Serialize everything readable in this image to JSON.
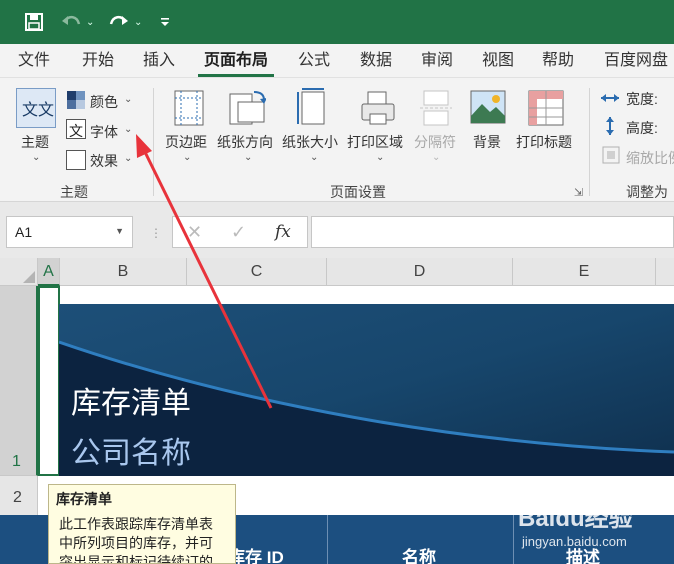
{
  "quick_access": {
    "save": "save-icon",
    "undo": "undo-icon",
    "redo": "redo-icon"
  },
  "tabs": [
    "文件",
    "开始",
    "插入",
    "页面布局",
    "公式",
    "数据",
    "审阅",
    "视图",
    "帮助",
    "百度网盘"
  ],
  "active_tab": "页面布局",
  "ribbon": {
    "themes": {
      "title": "主题",
      "theme_button": "主题",
      "theme_icon_text": "文文",
      "colors": "颜色",
      "fonts": "字体",
      "font_icon_text": "文",
      "effects": "效果"
    },
    "page_setup": {
      "title": "页面设置",
      "margins": "页边距",
      "orientation": "纸张方向",
      "size": "纸张大小",
      "print_area": "打印区域",
      "breaks": "分隔符",
      "background": "背景",
      "print_titles": "打印标题"
    },
    "scale": {
      "title": "调整为合",
      "width": "宽度:",
      "height": "高度:",
      "scale": "缩放比例"
    }
  },
  "formula_bar": {
    "name_box": "A1",
    "cancel": "✕",
    "enter": "✓",
    "fx": "fx",
    "value": ""
  },
  "columns": [
    "A",
    "B",
    "C",
    "D",
    "E"
  ],
  "rows": [
    "1",
    "2"
  ],
  "banner": {
    "title": "库存清单",
    "subtitle": "公司名称"
  },
  "table_headers": [
    "库存 ID",
    "名称",
    "描述"
  ],
  "tooltip": {
    "title": "库存清单",
    "lines": [
      "此工作表跟踪库存清单表",
      "中所列项目的库存，并可",
      "突出显示和标记待续订的"
    ]
  },
  "watermark": {
    "text": "Baidu经验",
    "url": "jingyan.baidu.com"
  },
  "colors": {
    "excel_green": "#217346",
    "banner_navy": "#163a5c",
    "header_blue": "#1c4f80",
    "arrow_red": "#e8333b"
  }
}
